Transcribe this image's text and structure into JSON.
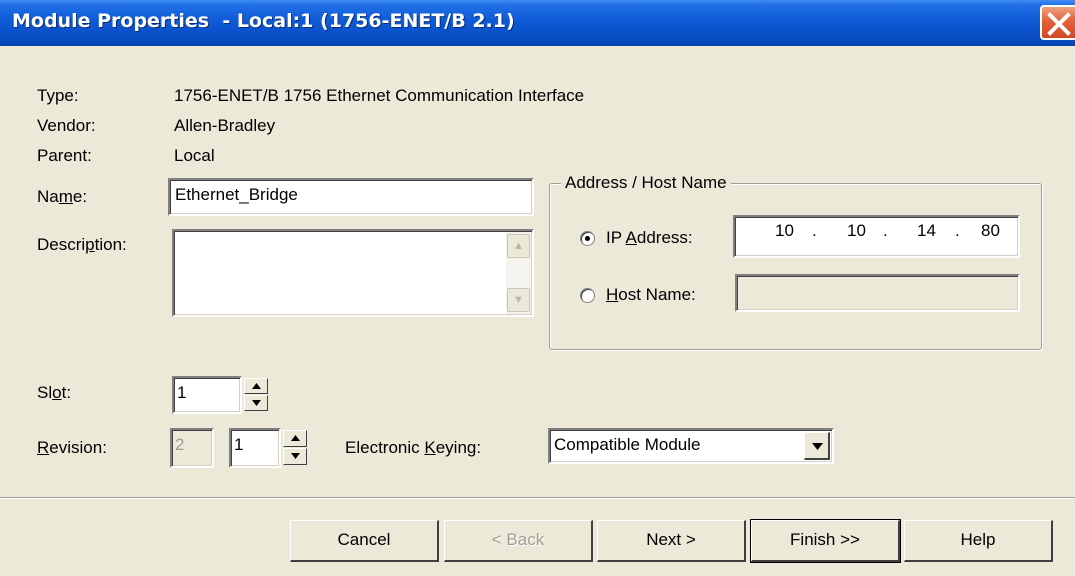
{
  "window": {
    "title": "Module Properties  - Local:1 (1756-ENET/B 2.1)",
    "close_icon": "close-x-icon"
  },
  "info": {
    "type_label": "Type:",
    "type_value": "1756-ENET/B 1756 Ethernet Communication Interface",
    "vendor_label": "Vendor:",
    "vendor_value": "Allen-Bradley",
    "parent_label": "Parent:",
    "parent_value": "Local"
  },
  "name": {
    "label_pre": "Na",
    "label_mnemonic": "m",
    "label_post": "e:",
    "value": "Ethernet_Bridge"
  },
  "description": {
    "label_pre": "Descri",
    "label_mnemonic": "p",
    "label_post": "tion:",
    "value": ""
  },
  "address": {
    "group_title": "Address / Host Name",
    "ip_label_pre": "IP ",
    "ip_label_mnemonic": "A",
    "ip_label_post": "ddress:",
    "ip_octets": [
      "10",
      "10",
      "14",
      "80"
    ],
    "ip_selected": true,
    "host_label_mnemonic": "H",
    "host_label_post": "ost Name:",
    "host_value": ""
  },
  "slot": {
    "label_pre": "Sl",
    "label_mnemonic": "o",
    "label_post": "t:",
    "value": "1"
  },
  "revision": {
    "label_mnemonic": "R",
    "label_post": "evision:",
    "major": "2",
    "minor": "1"
  },
  "keying": {
    "label_pre": "Electronic ",
    "label_mnemonic": "K",
    "label_post": "eying:",
    "value": "Compatible Module"
  },
  "buttons": {
    "cancel": "Cancel",
    "back": "< Back",
    "next": "Next >",
    "finish": "Finish >>",
    "help": "Help"
  }
}
